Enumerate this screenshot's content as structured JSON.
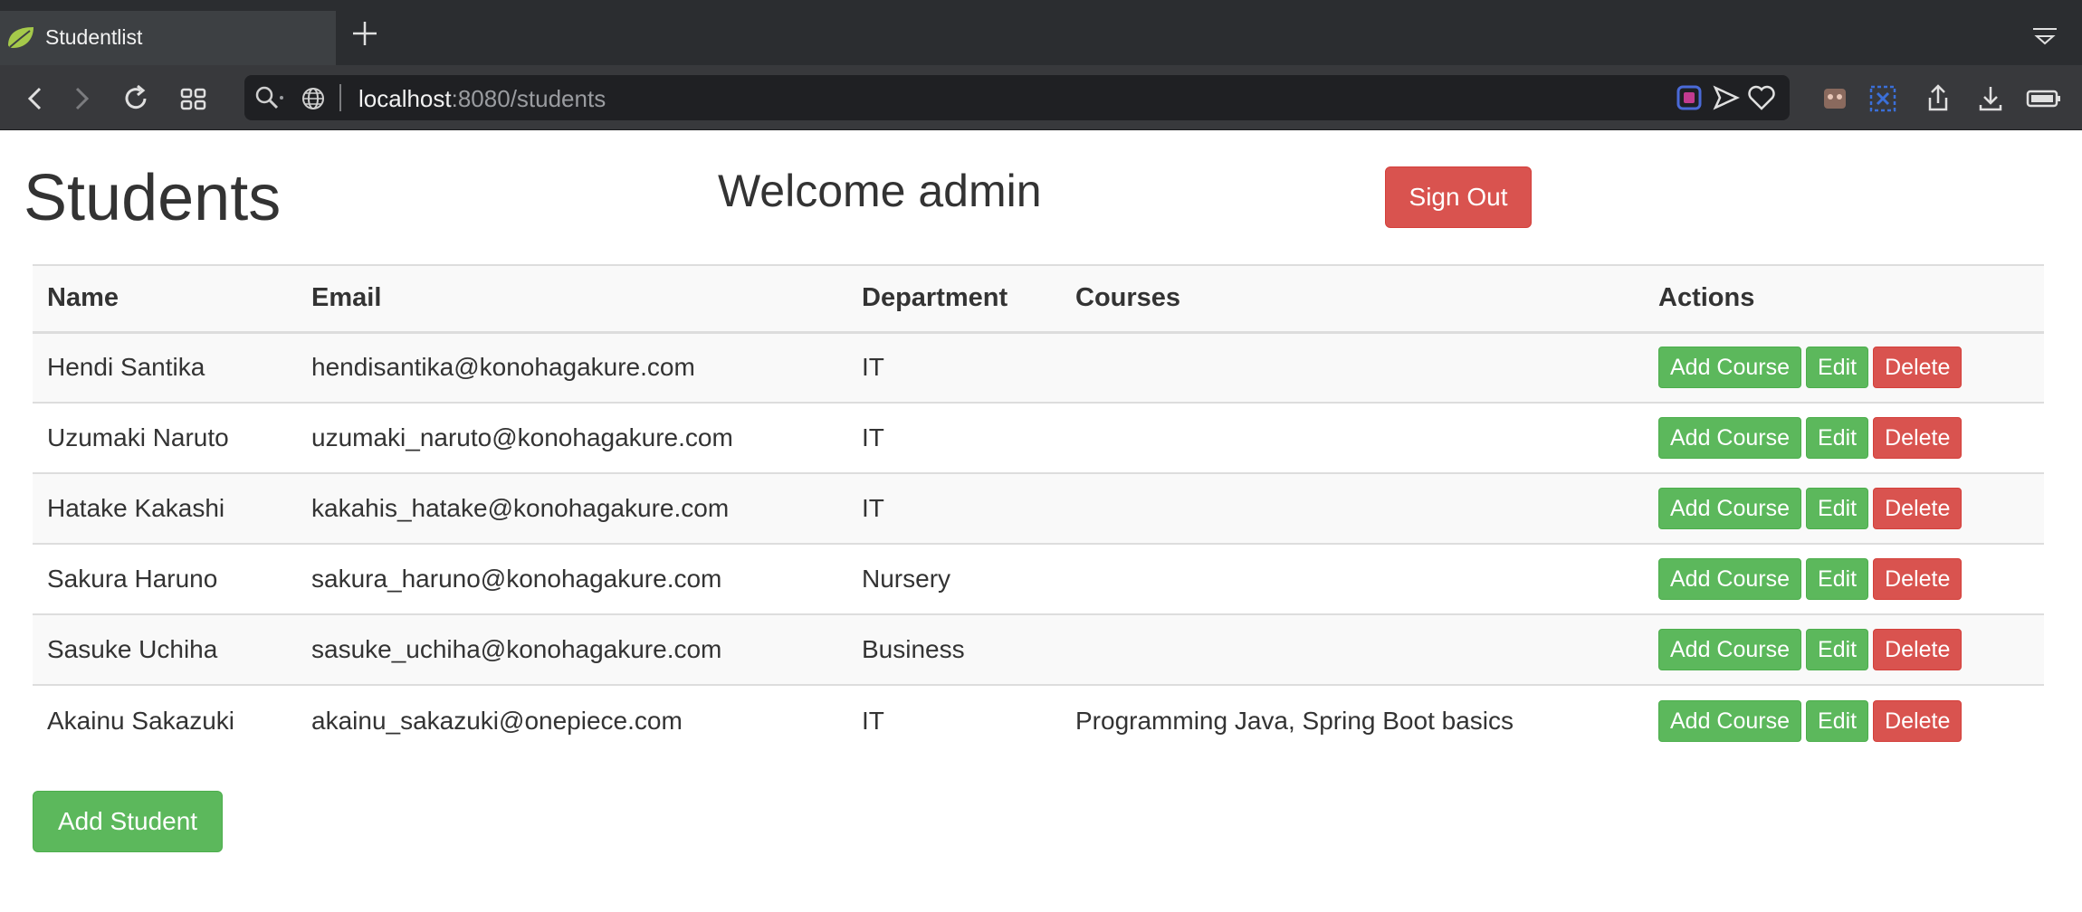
{
  "browser": {
    "tab": {
      "title": "Studentlist",
      "favicon": "spring-leaf-icon"
    },
    "url": {
      "host": "localhost",
      "rest": ":8080/students"
    },
    "colors": {
      "tabbar": "#2b2d30",
      "toolbar": "#38393c",
      "urlbar": "#1f2023"
    }
  },
  "page": {
    "title": "Students",
    "welcome": "Welcome admin",
    "signout_label": "Sign Out",
    "add_student_label": "Add Student"
  },
  "table": {
    "headers": [
      "Name",
      "Email",
      "Department",
      "Courses",
      "Actions"
    ],
    "rows": [
      {
        "name": "Hendi Santika",
        "email": "hendisantika@konohagakure.com",
        "department": "IT",
        "courses": ""
      },
      {
        "name": "Uzumaki Naruto",
        "email": "uzumaki_naruto@konohagakure.com",
        "department": "IT",
        "courses": ""
      },
      {
        "name": "Hatake Kakashi",
        "email": "kakahis_hatake@konohagakure.com",
        "department": "IT",
        "courses": ""
      },
      {
        "name": "Sakura Haruno",
        "email": "sakura_haruno@konohagakure.com",
        "department": "Nursery",
        "courses": ""
      },
      {
        "name": "Sasuke Uchiha",
        "email": "sasuke_uchiha@konohagakure.com",
        "department": "Business",
        "courses": ""
      },
      {
        "name": "Akainu Sakazuki",
        "email": "akainu_sakazuki@onepiece.com",
        "department": "IT",
        "courses": "Programming Java, Spring Boot basics"
      }
    ],
    "actions": {
      "add_course": "Add Course",
      "edit": "Edit",
      "delete": "Delete"
    }
  },
  "colors": {
    "success": "#5cb85c",
    "danger": "#d9534f",
    "text": "#333333"
  }
}
